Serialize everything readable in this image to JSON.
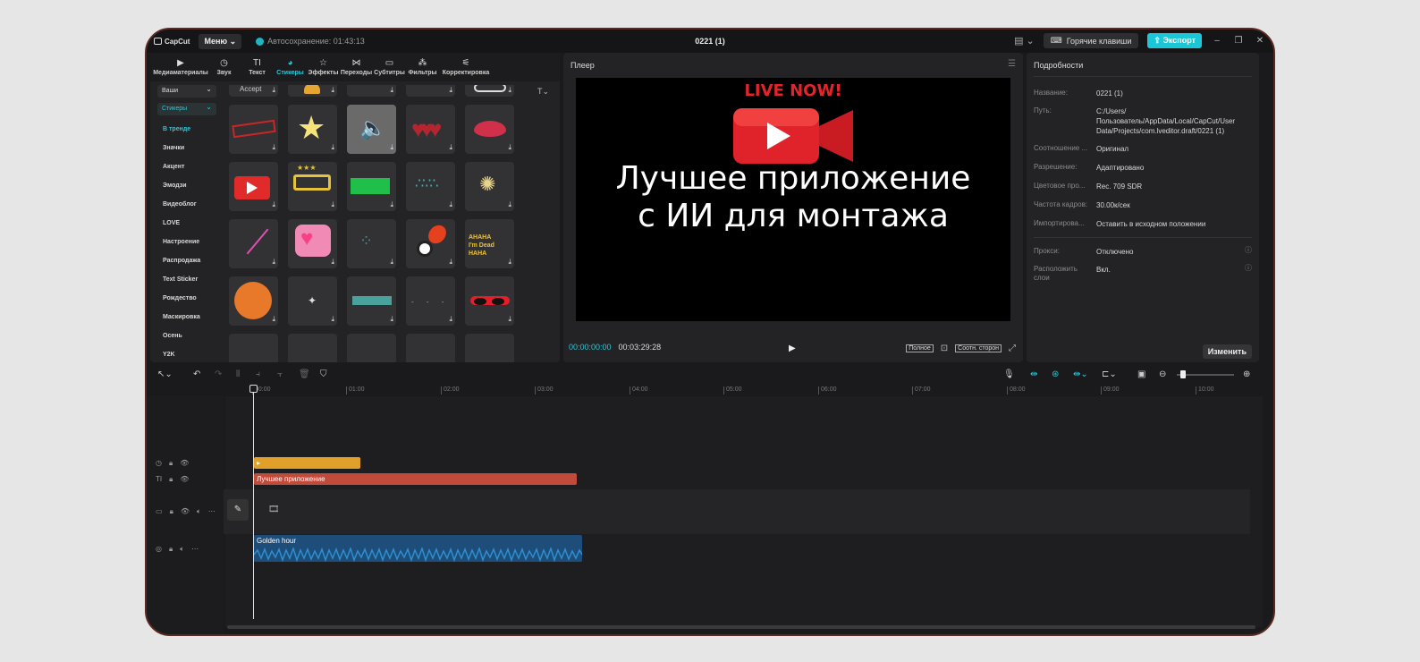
{
  "app": {
    "logo": "CapCut",
    "menu_label": "Меню",
    "autosave": "Автосохранение: 01:43:13",
    "project_title": "0221 (1)",
    "hotkeys_label": "Горячие клавиши",
    "export_label": "Экспорт",
    "accent_color": "#1bc6d6"
  },
  "toolbar": [
    {
      "label": "Медиаматериалы",
      "icon": "media-icon"
    },
    {
      "label": "Звук",
      "icon": "audio-icon"
    },
    {
      "label": "Текст",
      "icon": "text-icon"
    },
    {
      "label": "Стикеры",
      "icon": "sticker-icon",
      "active": true
    },
    {
      "label": "Эффекты",
      "icon": "effects-icon"
    },
    {
      "label": "Переходы",
      "icon": "transitions-icon"
    },
    {
      "label": "Субтитры",
      "icon": "subtitles-icon"
    },
    {
      "label": "Фильтры",
      "icon": "filters-icon"
    },
    {
      "label": "Корректировка",
      "icon": "adjust-icon"
    }
  ],
  "categories": {
    "yours": "Ваши",
    "stickers": "Стикеры",
    "items": [
      "В тренде",
      "Значки",
      "Акцент",
      "Эмодзи",
      "Видеоблог",
      "LOVE",
      "Настроение",
      "Распродажа",
      "Text Sticker",
      "Рождество",
      "Маскировка",
      "Осень",
      "Y2K"
    ]
  },
  "sticker_top_label": "Accept",
  "player": {
    "title": "Плеер",
    "live_text": "LIVE NOW!",
    "line1": "Лучшее приложение",
    "line2": "с ИИ для монтажа",
    "current_time": "00:00:00:00",
    "total_time": "00:03:29:28",
    "full_label": "Полное",
    "ratio_label": "Соотн. сторон"
  },
  "details": {
    "title": "Подробности",
    "rows": [
      {
        "key": "Название:",
        "value": "0221 (1)"
      },
      {
        "key": "Путь:",
        "value": "C:/Users/Пользователь/AppData/Local/CapCut/User Data/Projects/com.lveditor.draft/0221 (1)"
      },
      {
        "key": "Соотношение ...",
        "value": "Оригинал"
      },
      {
        "key": "Разрешение:",
        "value": "Адаптировано"
      },
      {
        "key": "Цветовое про...",
        "value": "Rec. 709 SDR"
      },
      {
        "key": "Частота кадров:",
        "value": "30.00к/сек"
      },
      {
        "key": "Импортирова...",
        "value": "Оставить в исходном положении"
      }
    ],
    "proxy_key": "Прокси:",
    "proxy_value": "Отключено",
    "layers_key": "Расположить слои",
    "layers_value": "Вкл.",
    "change_label": "Изменить"
  },
  "timeline": {
    "ticks": [
      "00:00",
      "01:00",
      "02:00",
      "03:00",
      "04:00",
      "05:00",
      "06:00",
      "07:00",
      "08:00",
      "09:00",
      "10:00"
    ],
    "text_clip": "Лучшее приложение",
    "audio_clip": "Golden hour"
  }
}
